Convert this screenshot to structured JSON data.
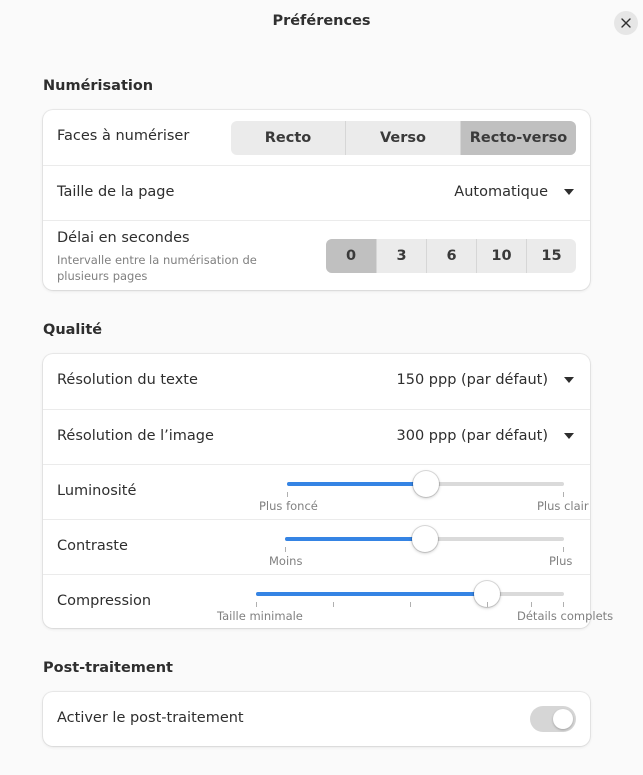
{
  "window": {
    "title": "Préférences",
    "close_icon": "close-icon"
  },
  "scanning": {
    "title": "Numérisation",
    "sides": {
      "label": "Faces à numériser",
      "options": [
        "Recto",
        "Verso",
        "Recto-verso"
      ],
      "selected": "Recto-verso"
    },
    "page_size": {
      "label": "Taille de la page",
      "value": "Automatique"
    },
    "delay": {
      "label": "Délai en secondes",
      "sublabel": "Intervalle entre la numérisation de plusieurs pages",
      "options": [
        "0",
        "3",
        "6",
        "10",
        "15"
      ],
      "selected": "0"
    }
  },
  "quality": {
    "title": "Qualité",
    "text_resolution": {
      "label": "Résolution du texte",
      "value": "150 ppp (par défaut)"
    },
    "image_resolution": {
      "label": "Résolution de l’image",
      "value": "300 ppp (par défaut)"
    },
    "brightness": {
      "label": "Luminosité",
      "min_label": "Plus foncé",
      "max_label": "Plus clair",
      "value": 0.5
    },
    "contrast": {
      "label": "Contraste",
      "min_label": "Moins",
      "max_label": "Plus",
      "value": 0.5
    },
    "compression": {
      "label": "Compression",
      "min_label": "Taille minimale",
      "max_label": "Détails complets",
      "value": 0.75
    }
  },
  "postprocessing": {
    "title": "Post-traitement",
    "enable": {
      "label": "Activer le post-traitement",
      "on": false
    }
  },
  "colors": {
    "accent": "#3584e4",
    "track": "#dadada",
    "selected_segment": "#c0c0c0"
  }
}
